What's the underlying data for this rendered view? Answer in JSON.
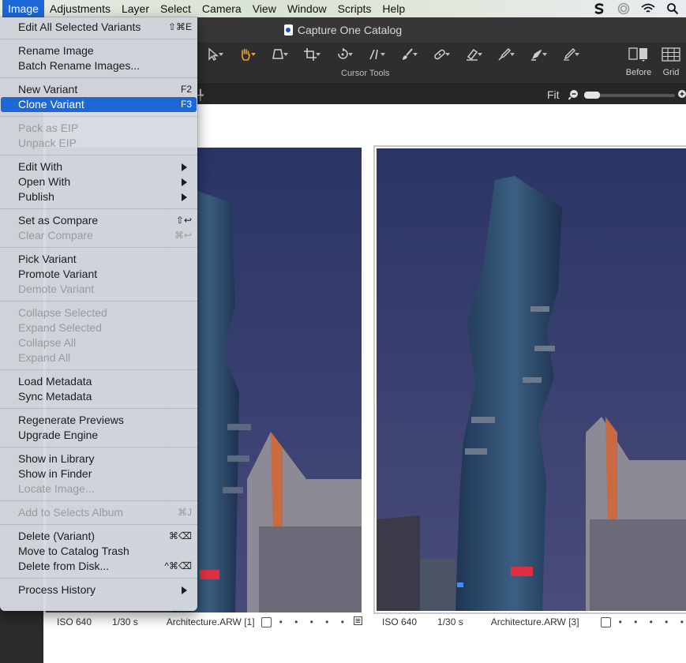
{
  "menubar": {
    "items": [
      "Image",
      "Adjustments",
      "Layer",
      "Select",
      "Camera",
      "View",
      "Window",
      "Scripts",
      "Help"
    ],
    "active": "Image",
    "status_icons": [
      "s-sync-icon",
      "circle-status-icon",
      "wifi-icon",
      "search-icon"
    ]
  },
  "window": {
    "title": "Capture One Catalog"
  },
  "toolbar": {
    "cursor_tools_label": "Cursor Tools",
    "tools": [
      "select-arrow-icon",
      "hand-pan-icon",
      "perspective-icon",
      "crop-icon",
      "rotate-icon",
      "straighten-icon",
      "brush-icon",
      "heal-icon",
      "eraser-icon",
      "color-picker-icon",
      "fill-icon",
      "annotate-icon"
    ],
    "active_tool": "hand-pan-icon",
    "before_label": "Before",
    "grid_label": "Grid"
  },
  "viewer_bar": {
    "fit_label": "Fit",
    "zoom_fraction": 0.15
  },
  "menu": {
    "groups": [
      [
        {
          "label": "Edit All Selected Variants",
          "shortcut": "⇧⌘E",
          "disabled": false
        }
      ],
      [
        {
          "label": "Rename Image",
          "shortcut": "",
          "disabled": false
        },
        {
          "label": "Batch Rename Images...",
          "shortcut": "",
          "disabled": false
        }
      ],
      [
        {
          "label": "New Variant",
          "shortcut": "F2",
          "disabled": false
        },
        {
          "label": "Clone Variant",
          "shortcut": "F3",
          "disabled": false,
          "highlight": true
        }
      ],
      [
        {
          "label": "Pack as EIP",
          "shortcut": "",
          "disabled": true
        },
        {
          "label": "Unpack EIP",
          "shortcut": "",
          "disabled": true
        }
      ],
      [
        {
          "label": "Edit With",
          "submenu": true,
          "disabled": false
        },
        {
          "label": "Open With",
          "submenu": true,
          "disabled": false
        },
        {
          "label": "Publish",
          "submenu": true,
          "disabled": false
        }
      ],
      [
        {
          "label": "Set as Compare",
          "shortcut": "⇧↩",
          "disabled": false
        },
        {
          "label": "Clear Compare",
          "shortcut": "⌘↩",
          "disabled": true
        }
      ],
      [
        {
          "label": "Pick Variant",
          "shortcut": "",
          "disabled": false
        },
        {
          "label": "Promote Variant",
          "shortcut": "",
          "disabled": false
        },
        {
          "label": "Demote Variant",
          "shortcut": "",
          "disabled": true
        }
      ],
      [
        {
          "label": "Collapse Selected",
          "shortcut": "",
          "disabled": true
        },
        {
          "label": "Expand Selected",
          "shortcut": "",
          "disabled": true
        },
        {
          "label": "Collapse All",
          "shortcut": "",
          "disabled": true
        },
        {
          "label": "Expand All",
          "shortcut": "",
          "disabled": true
        }
      ],
      [
        {
          "label": "Load Metadata",
          "shortcut": "",
          "disabled": false
        },
        {
          "label": "Sync Metadata",
          "shortcut": "",
          "disabled": false
        }
      ],
      [
        {
          "label": "Regenerate Previews",
          "shortcut": "",
          "disabled": false
        },
        {
          "label": "Upgrade Engine",
          "shortcut": "",
          "disabled": false
        }
      ],
      [
        {
          "label": "Show in Library",
          "shortcut": "",
          "disabled": false
        },
        {
          "label": "Show in Finder",
          "shortcut": "",
          "disabled": false
        },
        {
          "label": "Locate Image...",
          "shortcut": "",
          "disabled": true
        }
      ],
      [
        {
          "label": "Add to Selects Album",
          "shortcut": "⌘J",
          "disabled": true
        }
      ],
      [
        {
          "label": "Delete (Variant)",
          "shortcut": "⌘⌫",
          "disabled": false
        },
        {
          "label": "Move to Catalog Trash",
          "shortcut": "",
          "disabled": false
        },
        {
          "label": "Delete from Disk...",
          "shortcut": "^⌘⌫",
          "disabled": false
        }
      ],
      [
        {
          "label": "Process History",
          "submenu": true,
          "disabled": false
        }
      ]
    ]
  },
  "thumbnails": [
    {
      "iso": "ISO 640",
      "shutter": "1/30 s",
      "filename": "Architecture.ARW [1]",
      "dots": "• • • • •"
    },
    {
      "iso": "ISO 640",
      "shutter": "1/30 s",
      "filename": "Architecture.ARW [3]",
      "dots": "• • • • •"
    }
  ],
  "colors": {
    "menu_highlight": "#1d67d6",
    "toolbar_active": "#f0a020"
  }
}
